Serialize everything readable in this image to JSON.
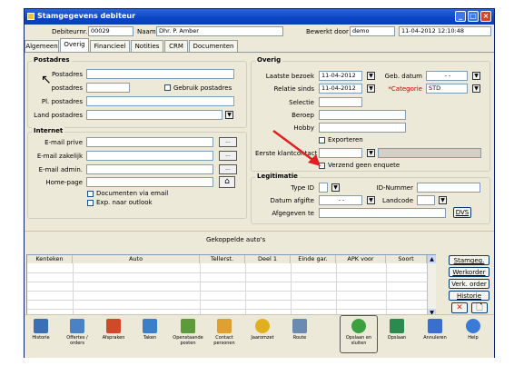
{
  "window": {
    "title": "Stamgegevens debiteur",
    "controls": [
      "_",
      "□",
      "×"
    ]
  },
  "header": {
    "debiteurnr_label": "Debiteurnr.",
    "debiteurnr_value": "00029",
    "naam_label": "Naam",
    "naam_value": "Dhr. P. Amber",
    "bewerkt_door_label": "Bewerkt door",
    "bewerkt_door_value": "demo",
    "datetime_value": "11-04-2012 12:10:48"
  },
  "tabs": [
    "Algemeen",
    "Overig",
    "Financieel",
    "Notities",
    "CRM",
    "Documenten"
  ],
  "postadres": {
    "title": "Postadres",
    "fields": [
      {
        "label": "Postadres",
        "value": ""
      },
      {
        "label": "postadres",
        "value": ""
      },
      {
        "label": "Pl. postadres",
        "value": ""
      },
      {
        "label": "Land postadres",
        "value": ""
      }
    ],
    "gebruik_postadres": "Gebruik postadres"
  },
  "internet": {
    "title": "Internet",
    "fields": [
      {
        "label": "E-mail prive",
        "value": ""
      },
      {
        "label": "E-mail zakelijk",
        "value": ""
      },
      {
        "label": "E-mail admin.",
        "value": ""
      },
      {
        "label": "Home-page",
        "value": ""
      }
    ],
    "documenten_via_email": "Documenten via email",
    "exp_naar_outlook": "Exp. naar outlook",
    "dots": "..."
  },
  "overig": {
    "title": "Overig",
    "laatste_bezoek_label": "Laatste bezoek",
    "laatste_bezoek_value": "11-04-2012",
    "relatie_sinds_label": "Relatie sinds",
    "relatie_sinds_value": "11-04-2012",
    "geb_datum_label": "Geb. datum",
    "geb_datum_value": "-    -",
    "categorie_label": "*Categorie",
    "categorie_value": "STD",
    "selectie_label": "Selectie",
    "beroep_label": "Beroep",
    "hobby_label": "Hobby",
    "exporteren": "Exporteren",
    "eerste_klantcontact_label": "Eerste klantcontact",
    "verzend_geen_enquete": "Verzend geen enquete"
  },
  "legitimatie": {
    "title": "Legitimatie",
    "type_id_label": "Type ID",
    "id_nummer_label": "ID-Nummer",
    "datum_afgifte_label": "Datum afgifte",
    "datum_afgifte_value": "-    -",
    "landcode_label": "Landcode",
    "afgegeven_te_label": "Afgegeven te",
    "dvs_button": "DVS"
  },
  "autos": {
    "title": "Gekoppelde auto's",
    "columns": [
      "Kenteken",
      "Auto",
      "Tellerst.",
      "Deel 1",
      "Einde gar.",
      "APK voor",
      "Soort"
    ],
    "buttons": [
      "Stamgeg.",
      "Werkorder",
      "Verk. order",
      "Historie"
    ]
  },
  "toolbar": [
    {
      "label": "Historie",
      "icon": "history-icon",
      "color": "#3a6fb5"
    },
    {
      "label": "Offertes / orders",
      "icon": "quotes-icon",
      "color": "#4a82c4"
    },
    {
      "label": "Afspraken",
      "icon": "calendar-icon",
      "color": "#d04a2a"
    },
    {
      "label": "Taken",
      "icon": "tasks-icon",
      "color": "#3a7fc8"
    },
    {
      "label": "Openstaande posten",
      "icon": "open-items-icon",
      "color": "#5c9a3a"
    },
    {
      "label": "Contact personen",
      "icon": "contacts-icon",
      "color": "#e0a030"
    },
    {
      "label": "Jaaromzet",
      "icon": "revenue-icon",
      "color": "#e0b020"
    },
    {
      "label": "Route",
      "icon": "route-icon",
      "color": "#6a8ab0"
    },
    {
      "label": "Opslaan en sluiten",
      "icon": "save-close-icon",
      "color": "#3aa040"
    },
    {
      "label": "Opslaan",
      "icon": "save-icon",
      "color": "#2a8a50"
    },
    {
      "label": "Annuleren",
      "icon": "cancel-icon",
      "color": "#3a6fd0"
    },
    {
      "label": "Help",
      "icon": "help-icon",
      "color": "#3a7ad8"
    }
  ],
  "annotation_arrow_color": "#e02020"
}
